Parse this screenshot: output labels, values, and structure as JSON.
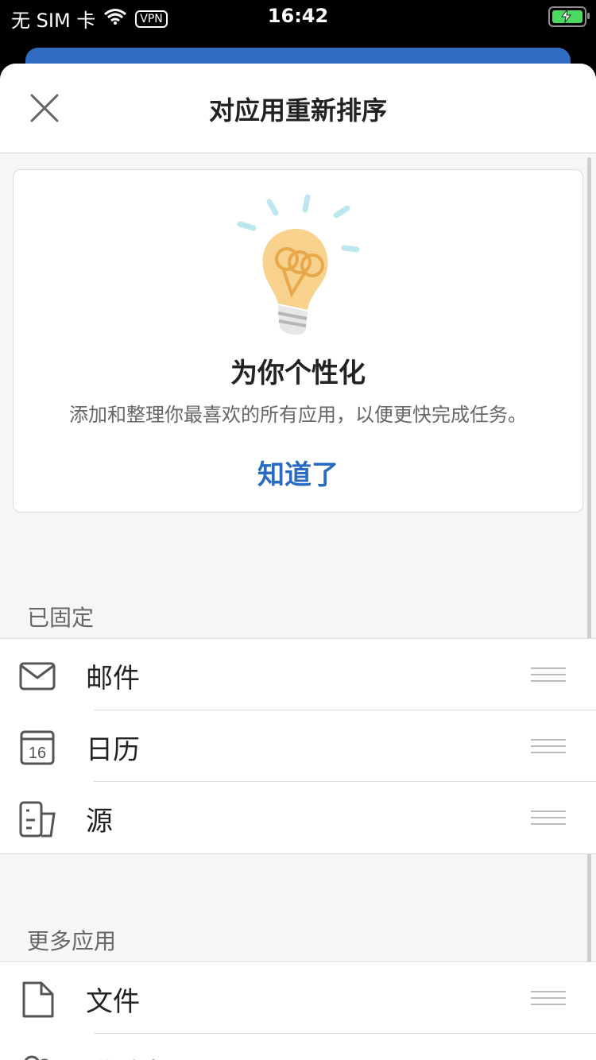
{
  "status_bar": {
    "carrier": "无 SIM 卡",
    "vpn": "VPN",
    "time": "16:42"
  },
  "header": {
    "title": "对应用重新排序"
  },
  "tip": {
    "title": "为你个性化",
    "description": "添加和整理你最喜欢的所有应用，以便更快完成任务。",
    "button_label": "知道了"
  },
  "pinned": {
    "label": "已固定",
    "items": [
      {
        "label": "邮件",
        "icon": "mail-icon"
      },
      {
        "label": "日历",
        "icon": "calendar-icon",
        "badge": "16"
      },
      {
        "label": "源",
        "icon": "feed-icon"
      }
    ]
  },
  "more_apps": {
    "label": "更多应用",
    "items": [
      {
        "label": "文件",
        "icon": "file-icon"
      },
      {
        "label": "联系人",
        "icon": "contacts-icon"
      }
    ]
  },
  "colors": {
    "accent": "#2a6bc2",
    "bulb": "#f8d28c",
    "ray": "#bde7ef"
  }
}
